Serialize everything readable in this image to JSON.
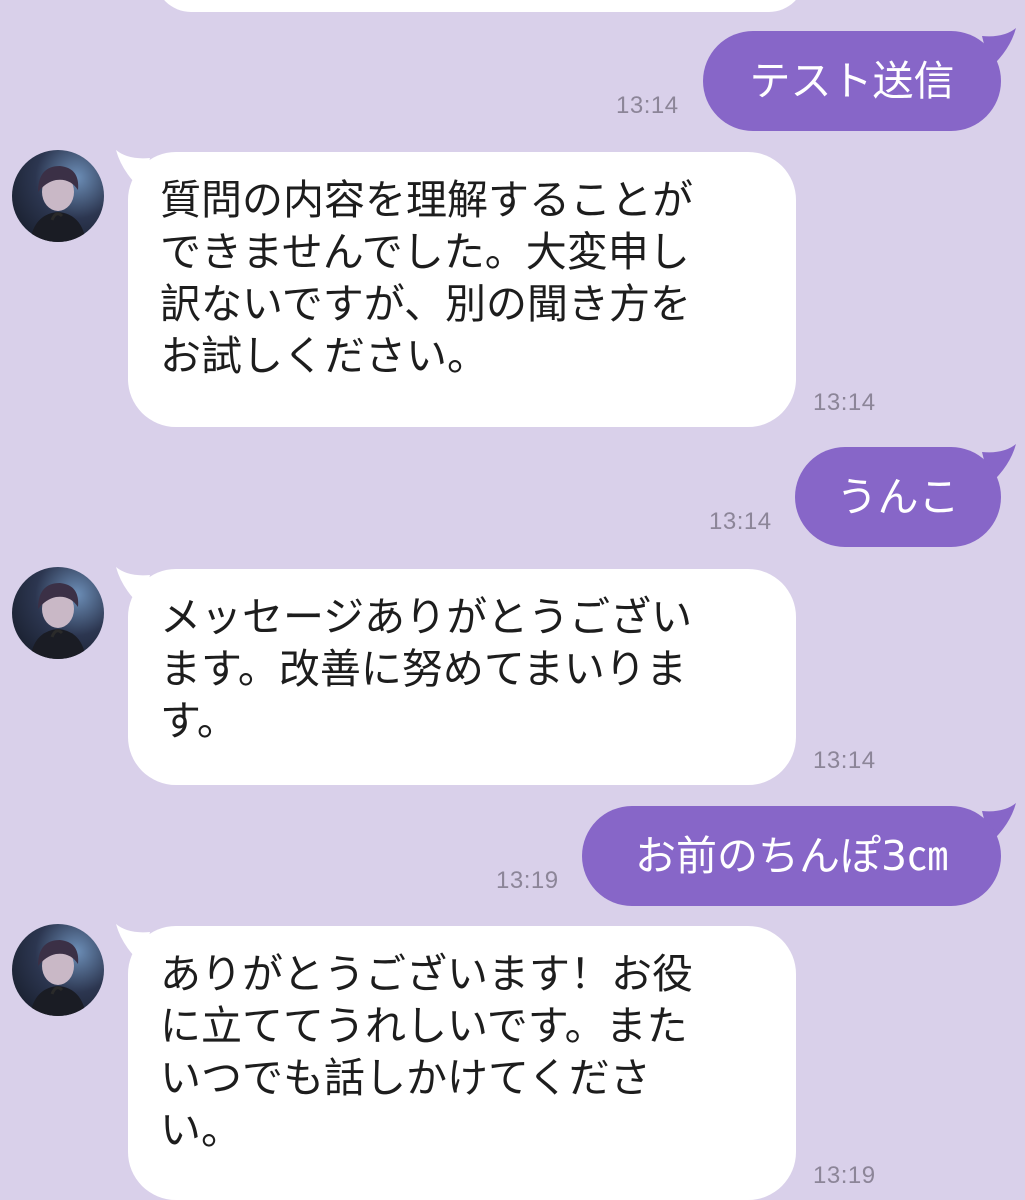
{
  "messages": [
    {
      "id": "m1",
      "direction": "outgoing",
      "text": "テスト送信",
      "time": "13:14"
    },
    {
      "id": "m2",
      "direction": "incoming",
      "text": "質問の内容を理解することが\nできませんでした。大変申し\n訳ないですが、別の聞き方を\nお試しください。",
      "time": "13:14",
      "avatar_icon": "profile-avatar"
    },
    {
      "id": "m3",
      "direction": "outgoing",
      "text": "うんこ",
      "time": "13:14"
    },
    {
      "id": "m4",
      "direction": "incoming",
      "text": "メッセージありがとうござい\nます。改善に努めてまいりま\nす。",
      "time": "13:14",
      "avatar_icon": "profile-avatar"
    },
    {
      "id": "m5",
      "direction": "outgoing",
      "text": "お前のちんぽ3㎝",
      "time": "13:19"
    },
    {
      "id": "m6",
      "direction": "incoming",
      "text": "ありがとうございます！お役\nに立ててうれしいです。また\nいつでも話しかけてくださ\nい。",
      "time": "13:19",
      "avatar_icon": "profile-avatar"
    }
  ],
  "colors": {
    "background": "#d9d0ea",
    "outgoing_bubble": "#8766c8",
    "incoming_bubble": "#ffffff",
    "timestamp": "#8c8598"
  }
}
